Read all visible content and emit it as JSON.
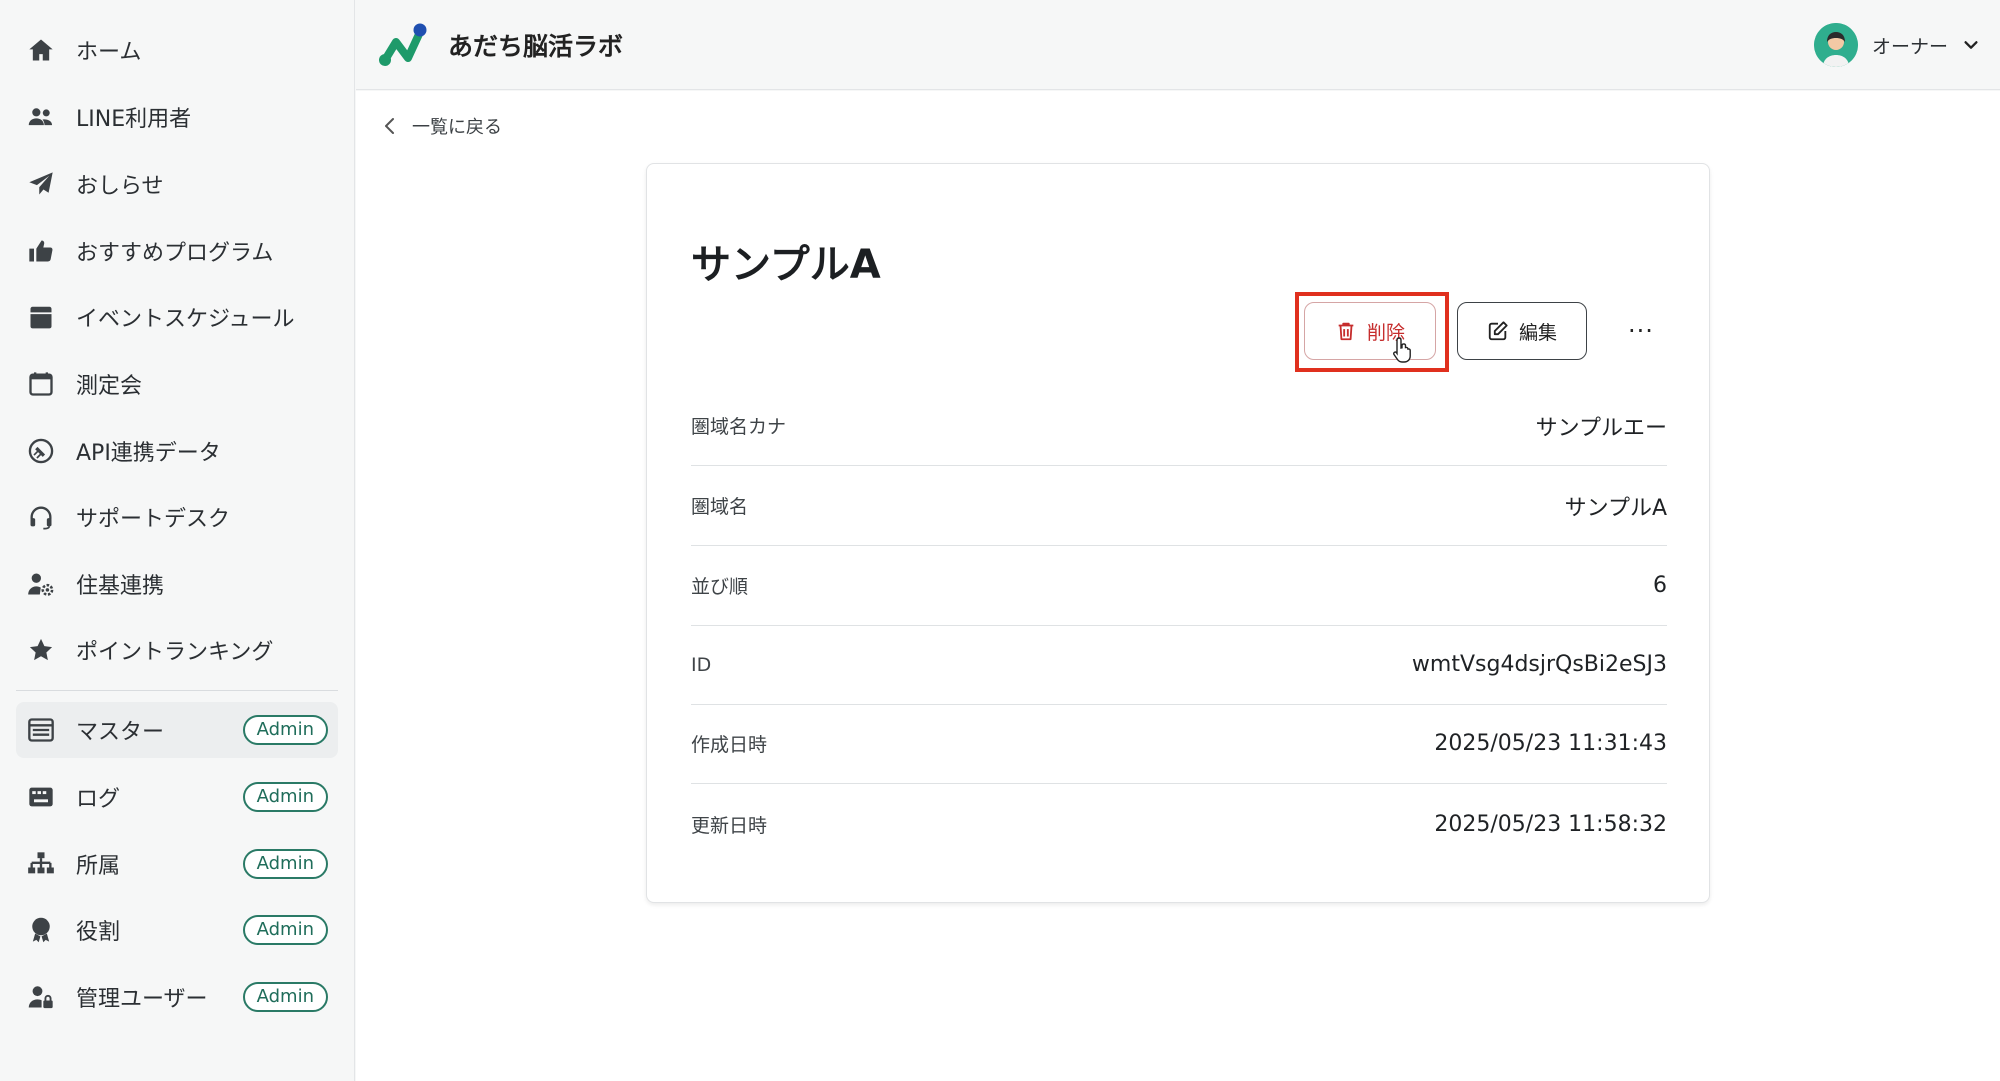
{
  "header": {
    "app_title": "あだち脳活ラボ",
    "user_name": "オーナー"
  },
  "sidebar": {
    "items": [
      {
        "label": "ホーム",
        "icon": "home-icon"
      },
      {
        "label": "LINE利用者",
        "icon": "users-icon"
      },
      {
        "label": "おしらせ",
        "icon": "paper-plane-icon"
      },
      {
        "label": "おすすめプログラム",
        "icon": "thumbs-up-icon"
      },
      {
        "label": "イベントスケジュール",
        "icon": "calendar-filled-icon"
      },
      {
        "label": "測定会",
        "icon": "calendar-outline-icon"
      },
      {
        "label": "API連携データ",
        "icon": "plug-icon"
      },
      {
        "label": "サポートデスク",
        "icon": "headset-icon"
      },
      {
        "label": "住基連携",
        "icon": "user-gear-icon"
      },
      {
        "label": "ポイントランキング",
        "icon": "star-icon"
      }
    ],
    "admin_items": [
      {
        "label": "マスター",
        "badge": "Admin",
        "icon": "master-icon"
      },
      {
        "label": "ログ",
        "badge": "Admin",
        "icon": "log-icon"
      },
      {
        "label": "所属",
        "badge": "Admin",
        "icon": "org-chart-icon"
      },
      {
        "label": "役割",
        "badge": "Admin",
        "icon": "award-icon"
      },
      {
        "label": "管理ユーザー",
        "badge": "Admin",
        "icon": "user-lock-icon"
      }
    ]
  },
  "main": {
    "back_label": "一覧に戻る",
    "title": "サンプルA",
    "delete_label": "削除",
    "edit_label": "編集",
    "more_label": "···",
    "fields": [
      {
        "label": "圏域名カナ",
        "value": "サンプルエー"
      },
      {
        "label": "圏域名",
        "value": "サンプルA"
      },
      {
        "label": "並び順",
        "value": "6"
      },
      {
        "label": "ID",
        "value": "wmtVsg4dsjrQsBi2eSJ3"
      },
      {
        "label": "作成日時",
        "value": "2025/05/23 11:31:43"
      },
      {
        "label": "更新日時",
        "value": "2025/05/23 11:58:32"
      }
    ]
  },
  "colors": {
    "accent_green": "#2a7a66",
    "delete_red": "#c62d2d",
    "highlight_red": "#e0301e"
  }
}
